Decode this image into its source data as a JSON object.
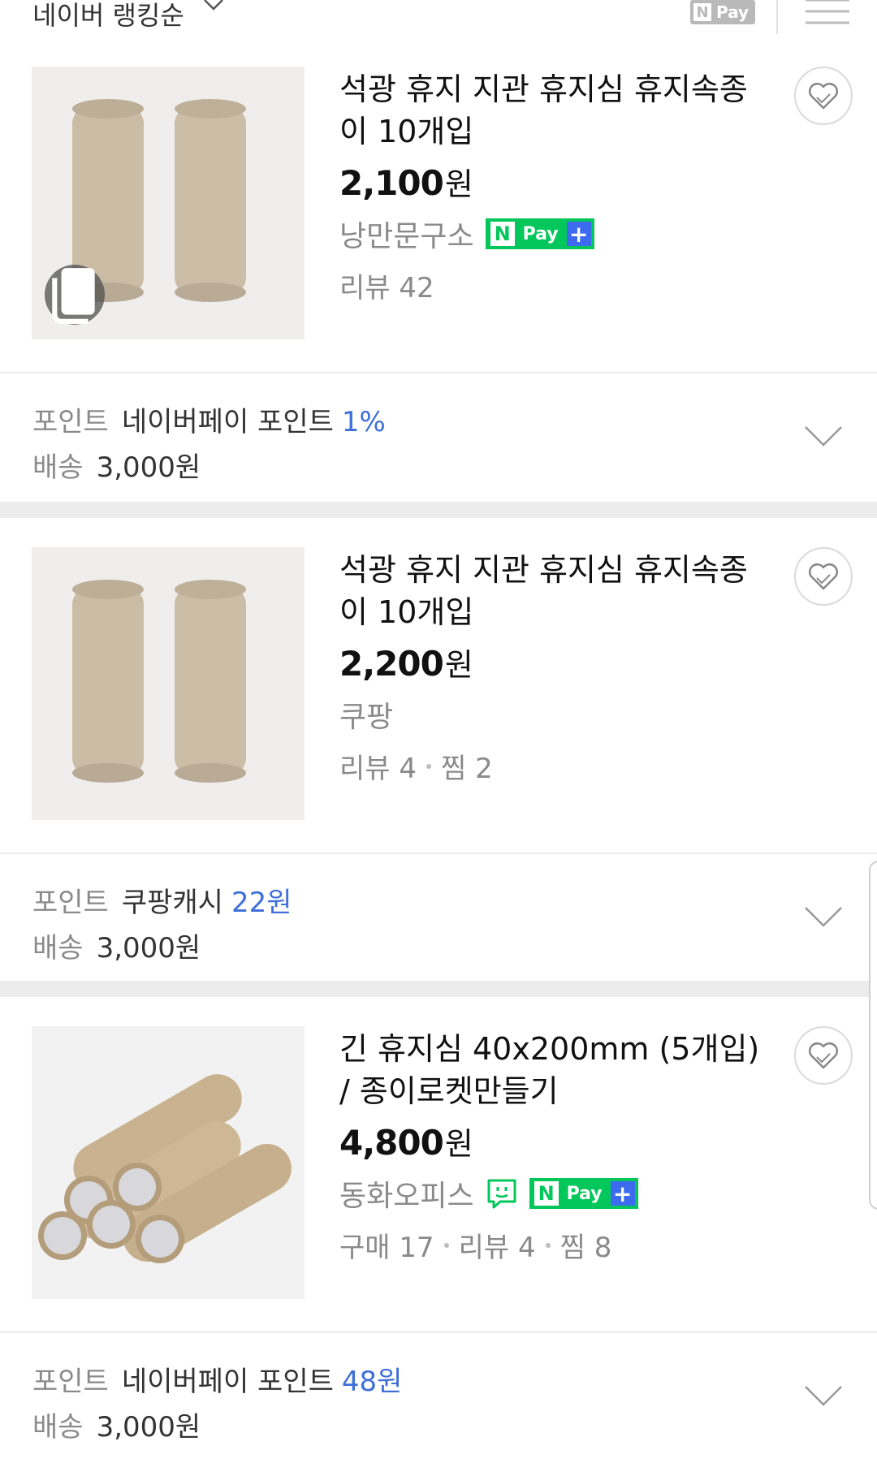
{
  "header": {
    "sort_label": "네이버 랭킹순",
    "npay_filter": {
      "n": "N",
      "pay": "Pay"
    }
  },
  "products": [
    {
      "title": "석광 휴지 지관 휴지심 휴지속종이 10개입",
      "price": "2,100",
      "currency": "원",
      "seller": "낭만문구소",
      "badges": {
        "talk": false,
        "npay_plus": true
      },
      "meta": [
        "리뷰 42"
      ],
      "benefit": {
        "point_label": "포인트",
        "point_text": "네이버페이 포인트",
        "point_value": "1%",
        "delivery_label": "배송",
        "delivery_fee": "3,000원"
      }
    },
    {
      "title": "석광 휴지 지관 휴지심 휴지속종이 10개입",
      "price": "2,200",
      "currency": "원",
      "seller": "쿠팡",
      "badges": {
        "talk": false,
        "npay_plus": false
      },
      "meta": [
        "리뷰 4",
        "찜 2"
      ],
      "benefit": {
        "point_label": "포인트",
        "point_text": "쿠팡캐시",
        "point_value": "22원",
        "delivery_label": "배송",
        "delivery_fee": "3,000원"
      }
    },
    {
      "title": "긴 휴지심 40x200mm (5개입) / 종이로켓만들기",
      "price": "4,800",
      "currency": "원",
      "seller": "동화오피스",
      "badges": {
        "talk": true,
        "npay_plus": true
      },
      "meta": [
        "구매 17",
        "리뷰 4",
        "찜 8"
      ],
      "benefit": {
        "point_label": "포인트",
        "point_text": "네이버페이 포인트",
        "point_value": "48원",
        "delivery_label": "배송",
        "delivery_fee": "3,000원"
      }
    }
  ],
  "npay_badge": {
    "n": "N",
    "pay": "Pay",
    "plus": "+"
  },
  "icons": [
    "chevron-down-icon",
    "list-view-icon",
    "multi-image-icon",
    "heart-icon",
    "talktalk-icon",
    "expand-chevron-icon"
  ],
  "colors": {
    "accent_blue": "#3f6fd8",
    "npay_green": "#03c75a",
    "npay_plus_blue": "#3c6bf0",
    "divider": "#ececec"
  }
}
